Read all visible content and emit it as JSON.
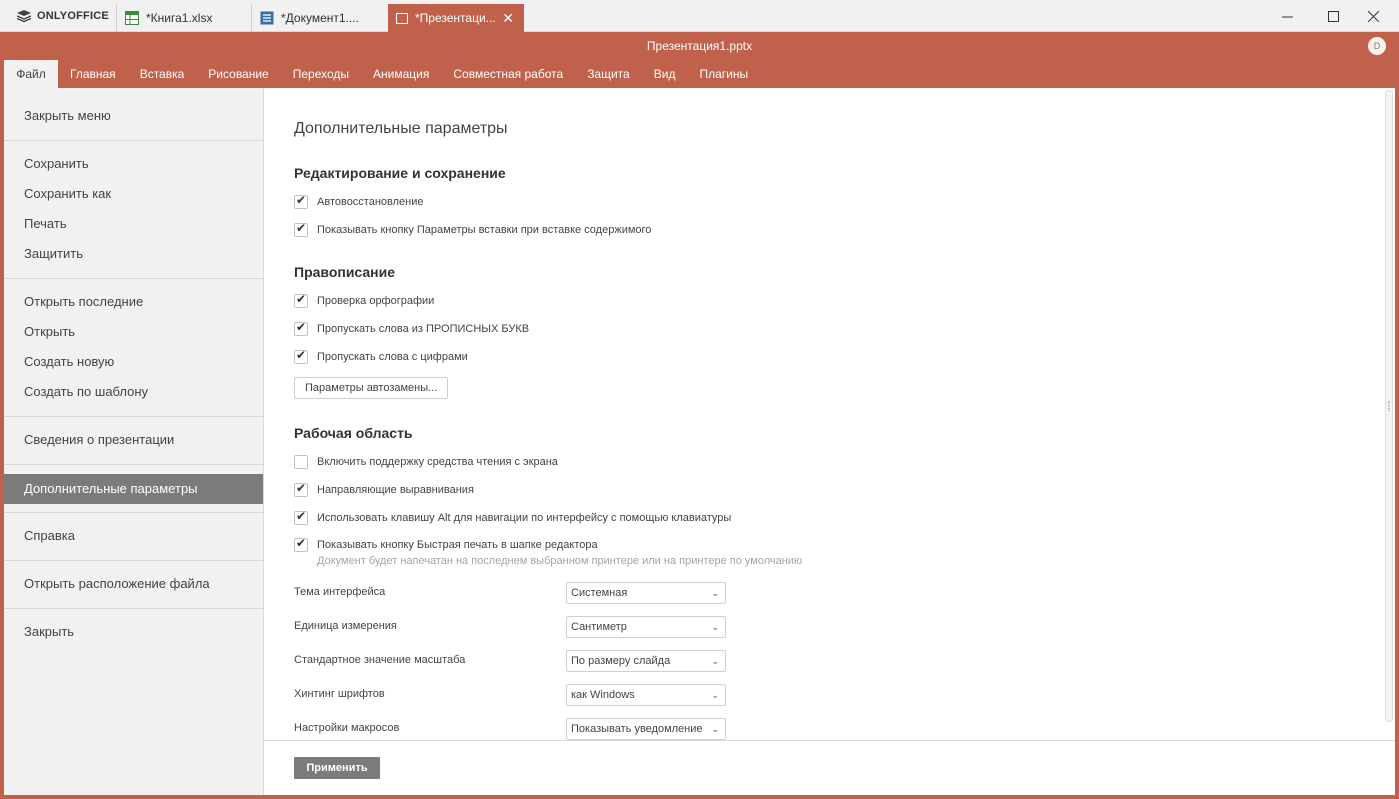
{
  "app": {
    "brand": "ONLYOFFICE",
    "tabs": [
      {
        "label": "*Книга1.xlsx",
        "icon": "spreadsheet-icon"
      },
      {
        "label": "*Документ1....",
        "icon": "document-icon"
      },
      {
        "label": "*Презентаци...",
        "icon": "presentation-icon"
      }
    ],
    "doc_title": "Презентация1.pptx",
    "avatar": "D"
  },
  "menu": [
    "Файл",
    "Главная",
    "Вставка",
    "Рисование",
    "Переходы",
    "Анимация",
    "Совместная работа",
    "Защита",
    "Вид",
    "Плагины"
  ],
  "sidebar": {
    "items": [
      "Закрыть меню",
      "Сохранить",
      "Сохранить как",
      "Печать",
      "Защитить",
      "Открыть последние",
      "Открыть",
      "Создать новую",
      "Создать по шаблону",
      "Сведения о презентации",
      "Дополнительные параметры",
      "Справка",
      "Открыть расположение файла",
      "Закрыть"
    ]
  },
  "settings": {
    "title": "Дополнительные параметры",
    "sections": {
      "editing": "Редактирование и сохранение",
      "spelling": "Правописание",
      "workspace": "Рабочая область"
    },
    "checks": {
      "autorecover": {
        "label": "Автовосстановление",
        "checked": true
      },
      "paste_button": {
        "label": "Показывать кнопку Параметры вставки при вставке содержимого",
        "checked": true
      },
      "spellcheck": {
        "label": "Проверка орфографии",
        "checked": true
      },
      "skip_caps": {
        "label": "Пропускать слова из ПРОПИСНЫХ БУКВ",
        "checked": true
      },
      "skip_digits": {
        "label": "Пропускать слова с цифрами",
        "checked": true
      },
      "screen_reader": {
        "label": "Включить поддержку средства чтения с экрана",
        "checked": false
      },
      "guides": {
        "label": "Направляющие выравнивания",
        "checked": true
      },
      "alt_nav": {
        "label": "Использовать клавишу Alt для навигации по интерфейсу с помощью клавиатуры",
        "checked": true
      },
      "quick_print": {
        "label": "Показывать кнопку Быстрая печать в шапке редактора",
        "checked": true
      }
    },
    "quick_print_note": "Документ будет напечатан на последнем выбранном принтере или на принтере по умолчанию",
    "autocorrect_button": "Параметры автозамены...",
    "selects": {
      "theme": {
        "label": "Тема интерфейса",
        "value": "Системная"
      },
      "unit": {
        "label": "Единица измерения",
        "value": "Сантиметр"
      },
      "zoom": {
        "label": "Стандартное значение масштаба",
        "value": "По размеру слайда"
      },
      "hinting": {
        "label": "Хинтинг шрифтов",
        "value": "как Windows"
      },
      "macros": {
        "label": "Настройки макросов",
        "value": "Показывать уведомление"
      }
    },
    "apply": "Применить"
  }
}
